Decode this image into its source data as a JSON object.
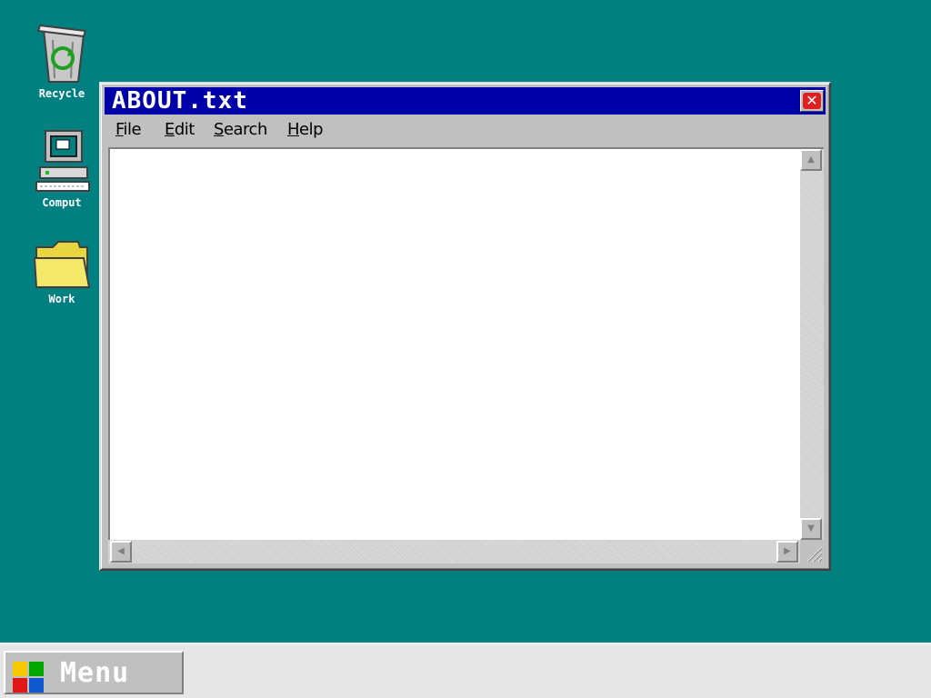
{
  "desktop": {
    "background_color": "#008080",
    "icons": [
      {
        "label": "Recycle",
        "icon": "recycle-bin-icon"
      },
      {
        "label": "Comput",
        "icon": "computer-icon"
      },
      {
        "label": "Work",
        "icon": "folder-icon"
      }
    ]
  },
  "window": {
    "title": "ABOUT.txt",
    "title_bar_color": "#0000a8",
    "close_label": "✕",
    "menu": [
      {
        "label": "File",
        "accel": "F",
        "rest": "ile"
      },
      {
        "label": "Edit",
        "accel": "E",
        "rest": "dit"
      },
      {
        "label": "Search",
        "accel": "S",
        "rest": "earch"
      },
      {
        "label": "Help",
        "accel": "H",
        "rest": "elp"
      }
    ],
    "content": "",
    "scroll_icons": {
      "up": "▲",
      "down": "▼",
      "left": "◀",
      "right": "▶"
    }
  },
  "taskbar": {
    "menu_label": "Menu",
    "logo_colors": [
      "#f8c800",
      "#00a800",
      "#e01818",
      "#1058d0"
    ]
  }
}
